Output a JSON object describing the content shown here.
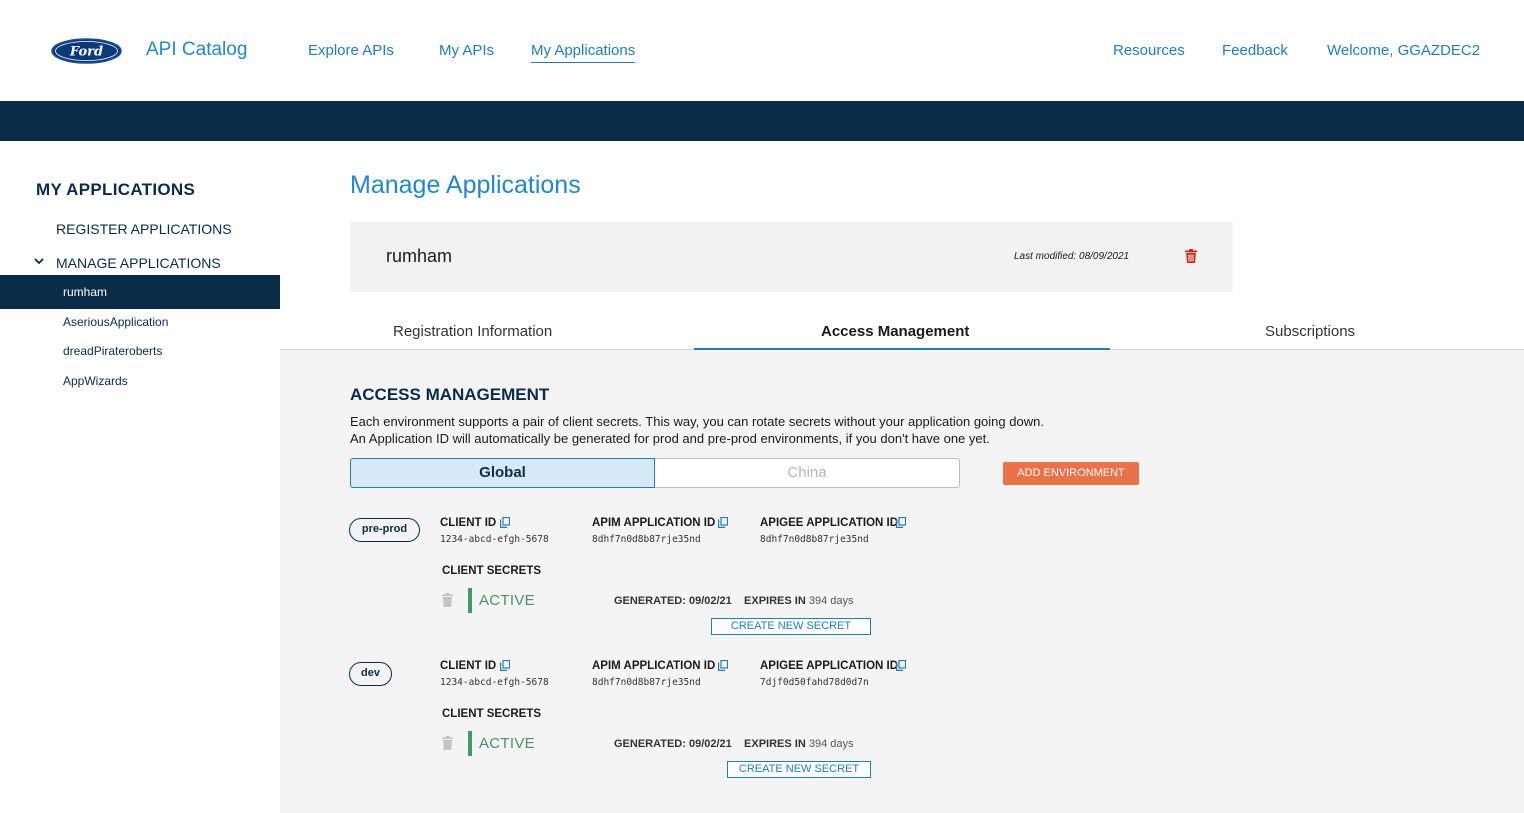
{
  "header": {
    "logo_text": "Ford",
    "brand": "API Catalog",
    "nav": [
      "Explore APIs",
      "My APIs",
      "My Applications"
    ],
    "right_nav": [
      "Resources",
      "Feedback",
      "Welcome, GGAZDEC2"
    ]
  },
  "sidebar": {
    "title": "MY APPLICATIONS",
    "register": "REGISTER APPLICATIONS",
    "manage": "MANAGE APPLICATIONS",
    "apps": [
      "rumham",
      "AseriousApplication",
      "dreadPirateroberts",
      "AppWizards"
    ]
  },
  "main": {
    "page_title": "Manage Applications",
    "app_name": "rumham",
    "last_modified": "Last modified: 08/09/2021",
    "tabs": [
      "Registration Information",
      "Access Management",
      "Subscriptions"
    ],
    "am_title": "ACCESS MANAGEMENT",
    "desc_line1": "Each environment supports a pair of client secrets. This way, you can rotate secrets without your application going down.",
    "desc_line2": "An Application ID will automatically be generated for prod and pre-prod environments, if you don't have one yet.",
    "segments": [
      "Global",
      "China"
    ],
    "add_env": "ADD ENVIRONMENT"
  },
  "environments": [
    {
      "name": "pre-prod",
      "client_id_label": "CLIENT ID",
      "client_id": "1234-abcd-efgh-5678",
      "apim_label": "APIM APPLICATION ID",
      "apim_id": "8dhf7n0d8b87rje35nd",
      "apigee_label": "APIGEE APPLICATION ID",
      "apigee_id": "8dhf7n0d8b87rje35nd",
      "secrets_label": "CLIENT SECRETS",
      "status": "ACTIVE",
      "generated": "GENERATED: 09/02/21",
      "expires_label": "EXPIRES IN",
      "expires_days": "394 days",
      "create_btn": "CREATE NEW SECRET"
    },
    {
      "name": "dev",
      "client_id_label": "CLIENT ID",
      "client_id": "1234-abcd-efgh-5678",
      "apim_label": "APIM APPLICATION ID",
      "apim_id": "8dhf7n0d8b87rje35nd",
      "apigee_label": "APIGEE APPLICATION ID",
      "apigee_id": "7djf0d50fahd78d0d7n",
      "secrets_label": "CLIENT SECRETS",
      "status": "ACTIVE",
      "generated": "GENERATED: 09/02/21",
      "expires_label": "EXPIRES IN",
      "expires_days": "394 days",
      "create_btn": "CREATE NEW SECRET"
    }
  ],
  "colors": {
    "navy": "#0b2c48",
    "brand_blue": "#1e8ac9",
    "link_blue": "#1e7fbf",
    "orange": "#ea7148",
    "active_green": "#3f9a6c",
    "delete_red": "#c8281e"
  }
}
